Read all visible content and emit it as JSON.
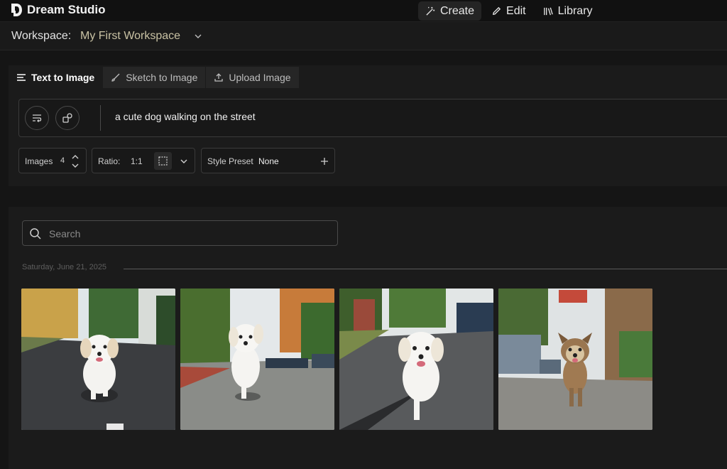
{
  "app": {
    "brand": "Dream Studio"
  },
  "nav": {
    "create": "Create",
    "edit": "Edit",
    "library": "Library"
  },
  "workspace": {
    "label": "Workspace:",
    "name": "My First Workspace"
  },
  "tabs": [
    {
      "label": "Text to Image",
      "active": true
    },
    {
      "label": "Sketch to Image",
      "active": false
    },
    {
      "label": "Upload Image",
      "active": false
    }
  ],
  "prompt": {
    "text": "a cute dog walking on the street"
  },
  "controls": {
    "images_label": "Images",
    "images_value": "4",
    "ratio_label": "Ratio:",
    "ratio_value": "1:1",
    "style_label": "Style Preset",
    "style_value": "None"
  },
  "gallery": {
    "search_placeholder": "Search",
    "date": "Saturday, June 21, 2025",
    "image_count": 4
  },
  "colors": {
    "background": "#151515",
    "panel": "#1b1b1b",
    "workspace_name": "#c9c2a4"
  }
}
